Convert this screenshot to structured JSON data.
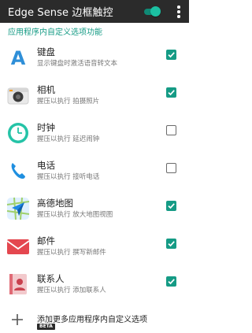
{
  "appbar": {
    "title": "Edge Sense 边框触控",
    "toggle_on": true
  },
  "section": {
    "header": "应用程序内自定义选项功能"
  },
  "items": [
    {
      "title": "键盘",
      "subtitle": "显示键盘时激活语音转文本",
      "icon": "keyboard-icon",
      "checked": true
    },
    {
      "title": "相机",
      "subtitle": "握压以执行 拍摄照片",
      "icon": "camera-icon",
      "checked": true
    },
    {
      "title": "时钟",
      "subtitle": "握压以执行 延迟闹钟",
      "icon": "clock-icon",
      "checked": false
    },
    {
      "title": "电话",
      "subtitle": "握压以执行 接听电话",
      "icon": "phone-icon",
      "checked": false
    },
    {
      "title": "高德地图",
      "subtitle": "握压以执行 放大地图视图",
      "icon": "amap-icon",
      "checked": true
    },
    {
      "title": "邮件",
      "subtitle": "握压以执行 撰写新邮件",
      "icon": "mail-icon",
      "checked": true
    },
    {
      "title": "联系人",
      "subtitle": "握压以执行 添加联系人",
      "icon": "contacts-icon",
      "checked": true
    }
  ],
  "add_more": {
    "label": "添加更多应用程序内自定义选项",
    "badge": "BETA"
  },
  "colors": {
    "accent": "#159b85",
    "appbar": "#2b2b2b"
  }
}
